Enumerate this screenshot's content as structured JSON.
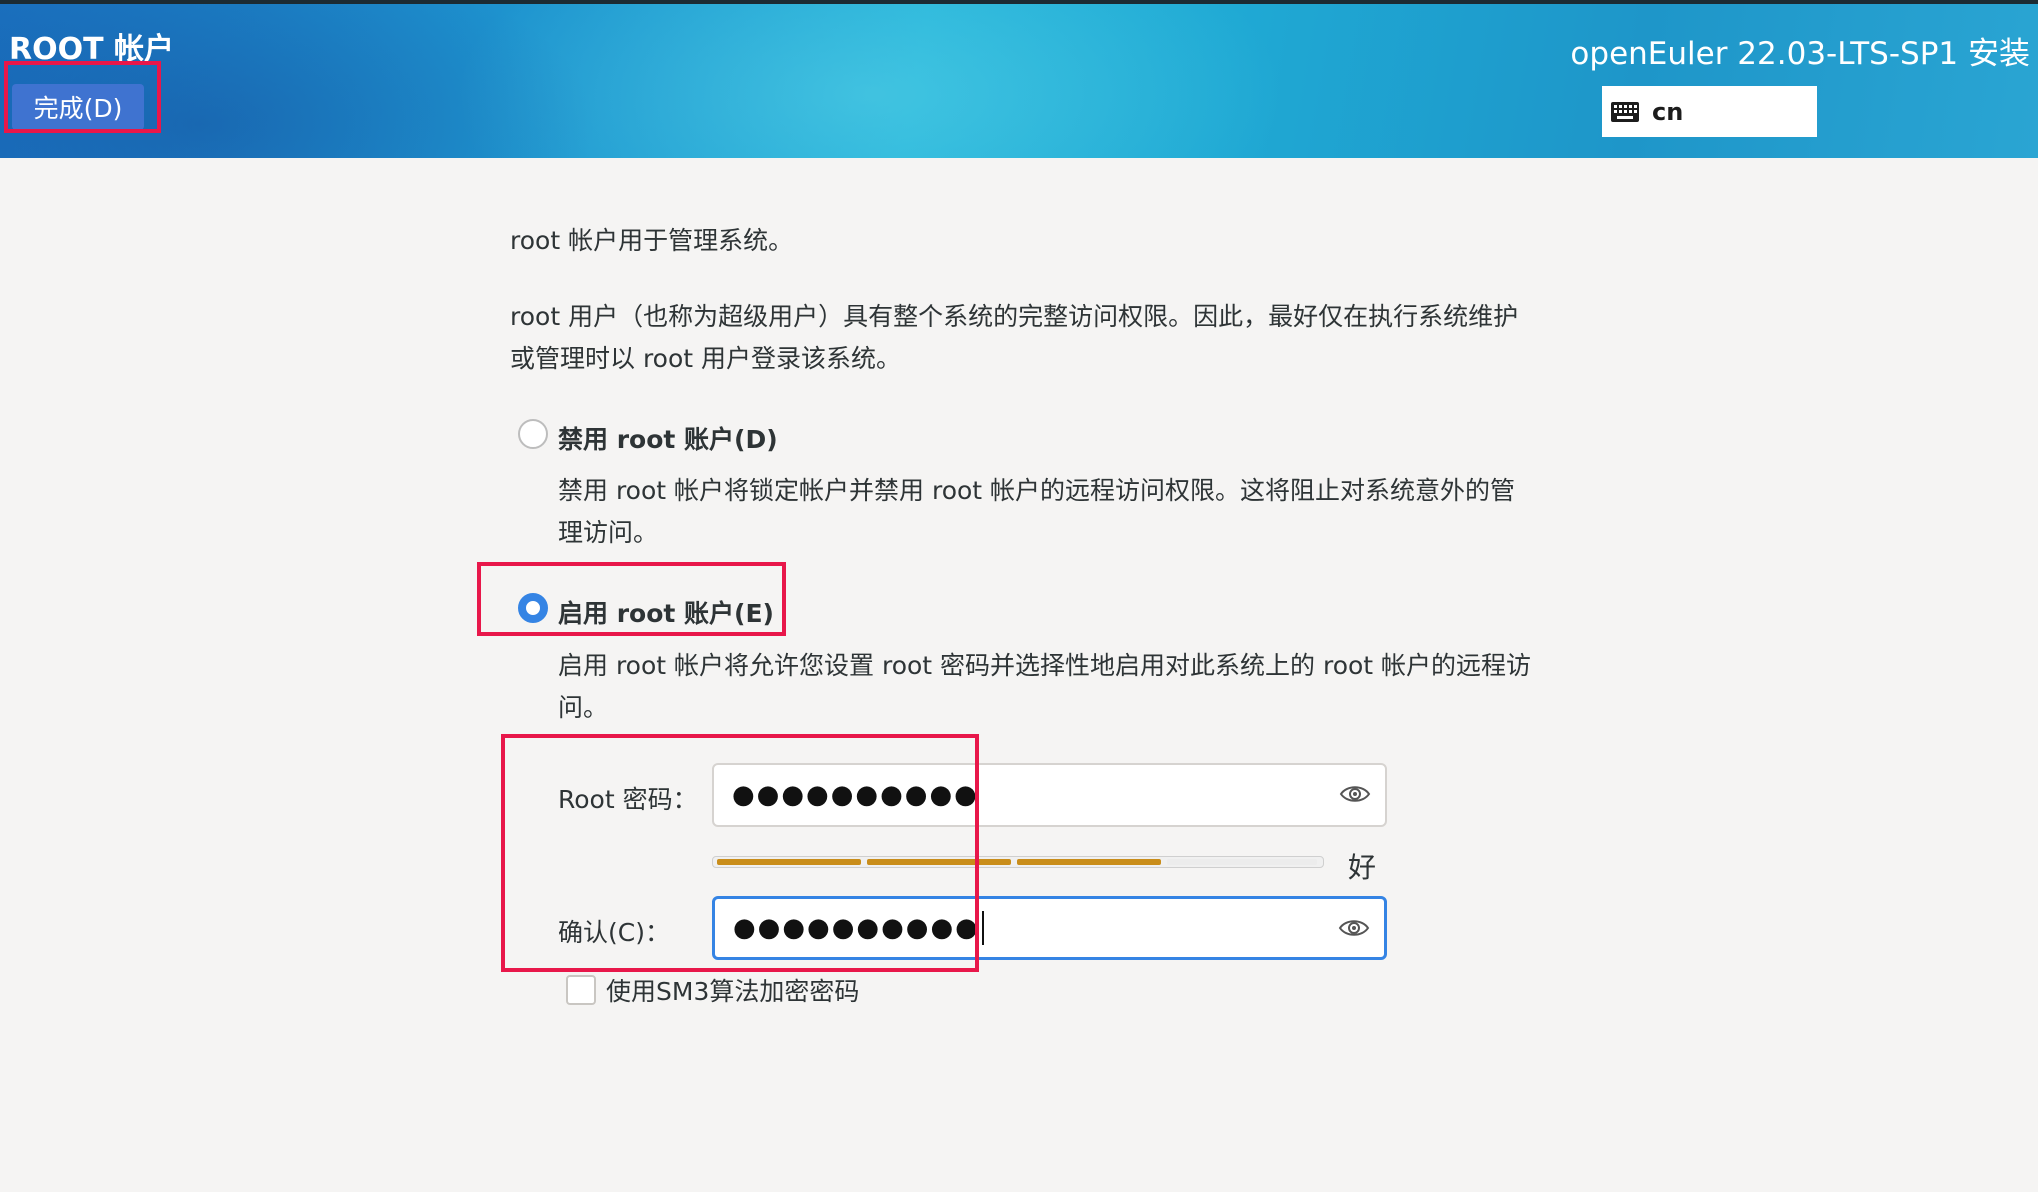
{
  "header": {
    "title": "ROOT 帐户",
    "done_button": "完成(D)",
    "product_title": "openEuler 22.03-LTS-SP1 安装",
    "keyboard_layout": "cn"
  },
  "intro": {
    "line1": "root 帐户用于管理系统。",
    "line2": "root 用户（也称为超级用户）具有整个系统的完整访问权限。因此，最好仅在执行系统维护或管理时以 root 用户登录该系统。"
  },
  "options": {
    "disable": {
      "label": "禁用 root 账户(D)",
      "description": "禁用 root 帐户将锁定帐户并禁用 root 帐户的远程访问权限。这将阻止对系统意外的管理访问。",
      "selected": false
    },
    "enable": {
      "label": "启用 root 账户(E)",
      "description": "启用 root 帐户将允许您设置 root 密码并选择性地启用对此系统上的 root 帐户的远程访问。",
      "selected": true
    }
  },
  "password": {
    "label": "Root 密码：",
    "value_masked": "●●●●●●●●●●",
    "strength_fraction": 0.75,
    "strength_text": "好"
  },
  "confirm": {
    "label": "确认(C)：",
    "value_masked": "●●●●●●●●●●"
  },
  "sm3_checkbox": {
    "label": "使用SM3算法加密密码",
    "checked": false
  },
  "colors": {
    "accent": "#3584e4",
    "done_button": "#3f73d0",
    "highlight_box": "#e8174a",
    "strength_bar": "#c98d1a"
  },
  "icons": [
    "keyboard-icon",
    "eye-icon"
  ]
}
